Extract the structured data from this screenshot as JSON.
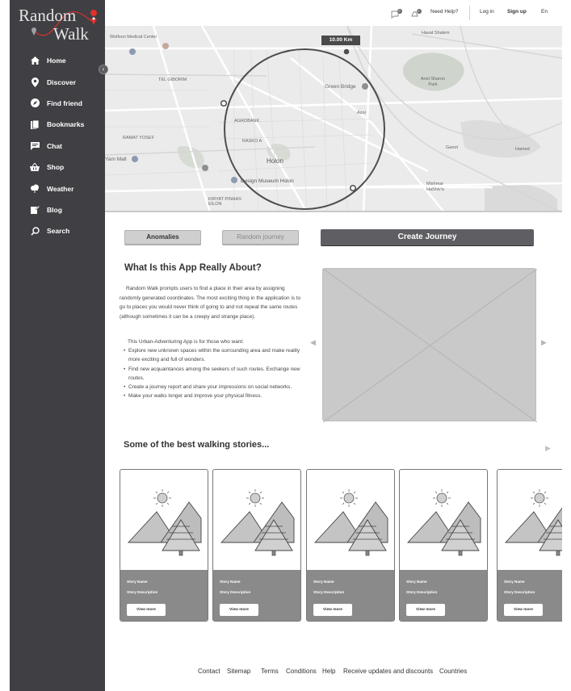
{
  "brand": {
    "word1": "Random",
    "word2": "Walk"
  },
  "sidebar": {
    "items": [
      {
        "label": "Home",
        "icon": "home-icon"
      },
      {
        "label": "Discover",
        "icon": "location-pin-icon"
      },
      {
        "label": "Find friend",
        "icon": "compass-icon"
      },
      {
        "label": "Bookmarks",
        "icon": "bookmark-icon"
      },
      {
        "label": "Chat",
        "icon": "chat-icon"
      },
      {
        "label": "Shop",
        "icon": "shopping-basket-icon"
      },
      {
        "label": "Weather",
        "icon": "cloud-icon"
      },
      {
        "label": "Blog",
        "icon": "edit-note-icon"
      },
      {
        "label": "Search",
        "icon": "search-icon"
      }
    ]
  },
  "topbar": {
    "notifications_count": "0",
    "messages_count": "0",
    "help": "Need Help?",
    "login": "Log in",
    "signup": "Sign up",
    "language": "En"
  },
  "map": {
    "distance": "10.00 Km",
    "labels": [
      "Wolfson Medical Center",
      "TEL GIBORIM",
      "AGROBANK",
      "RASKO A",
      "Holon",
      "RAMAT YOSEF",
      "Yam Mall",
      "Design Museum Holon",
      "KIRYAT PINHAS EILON",
      "Green Bridge",
      "Azor",
      "Ariel Sharon Park",
      "Havat Shalem",
      "Ganot",
      "Mishmar HaShiv'a",
      "Hamed"
    ]
  },
  "actions": {
    "anomalies": "Anomalies",
    "random_journey": "Random journey",
    "create_journey": "Create Journey"
  },
  "about": {
    "title": "What Is this App Really About?",
    "paragraph": "Random Walk prompts users to find a place in their area by assigning randomly generated coordinates. The most exciting thing in the application is to go to places you would never think of going to and not repeat the same routes (although sometimes it can be a creepy and strange place).",
    "intro": "This  Urban-Adventuring App is for those who want:",
    "bullets": [
      "Explore new unknown spaces within the surrounding area and make reality more exciting and full of wonders.",
      "Find new acquaintances among the seekers of such routes. Exchange new routes.",
      "Create a journey report and share your impressions on social networks.",
      "Make your walks longer and improve your physical fitness."
    ]
  },
  "stories": {
    "title": "Some of the best walking stories...",
    "cards": [
      {
        "name": "Story Name",
        "description": "Story Description",
        "button": "View more"
      },
      {
        "name": "Story Name",
        "description": "Story Description",
        "button": "View more"
      },
      {
        "name": "Story Name",
        "description": "Story Description",
        "button": "View more"
      },
      {
        "name": "Story Name",
        "description": "Story Description",
        "button": "View more"
      },
      {
        "name": "Story Name",
        "description": "Story Description",
        "button": "View more"
      }
    ]
  },
  "footer": {
    "links": [
      "Contact",
      "Sitemap",
      "Terms",
      "Conditions",
      "Help",
      "Receive updates and discounts",
      "Countries"
    ]
  },
  "colors": {
    "sidebar_bg": "#3f3f44",
    "accent_red": "#e0312a",
    "primary_button": "#5e5e63",
    "card_footer": "#8a8a8a"
  }
}
